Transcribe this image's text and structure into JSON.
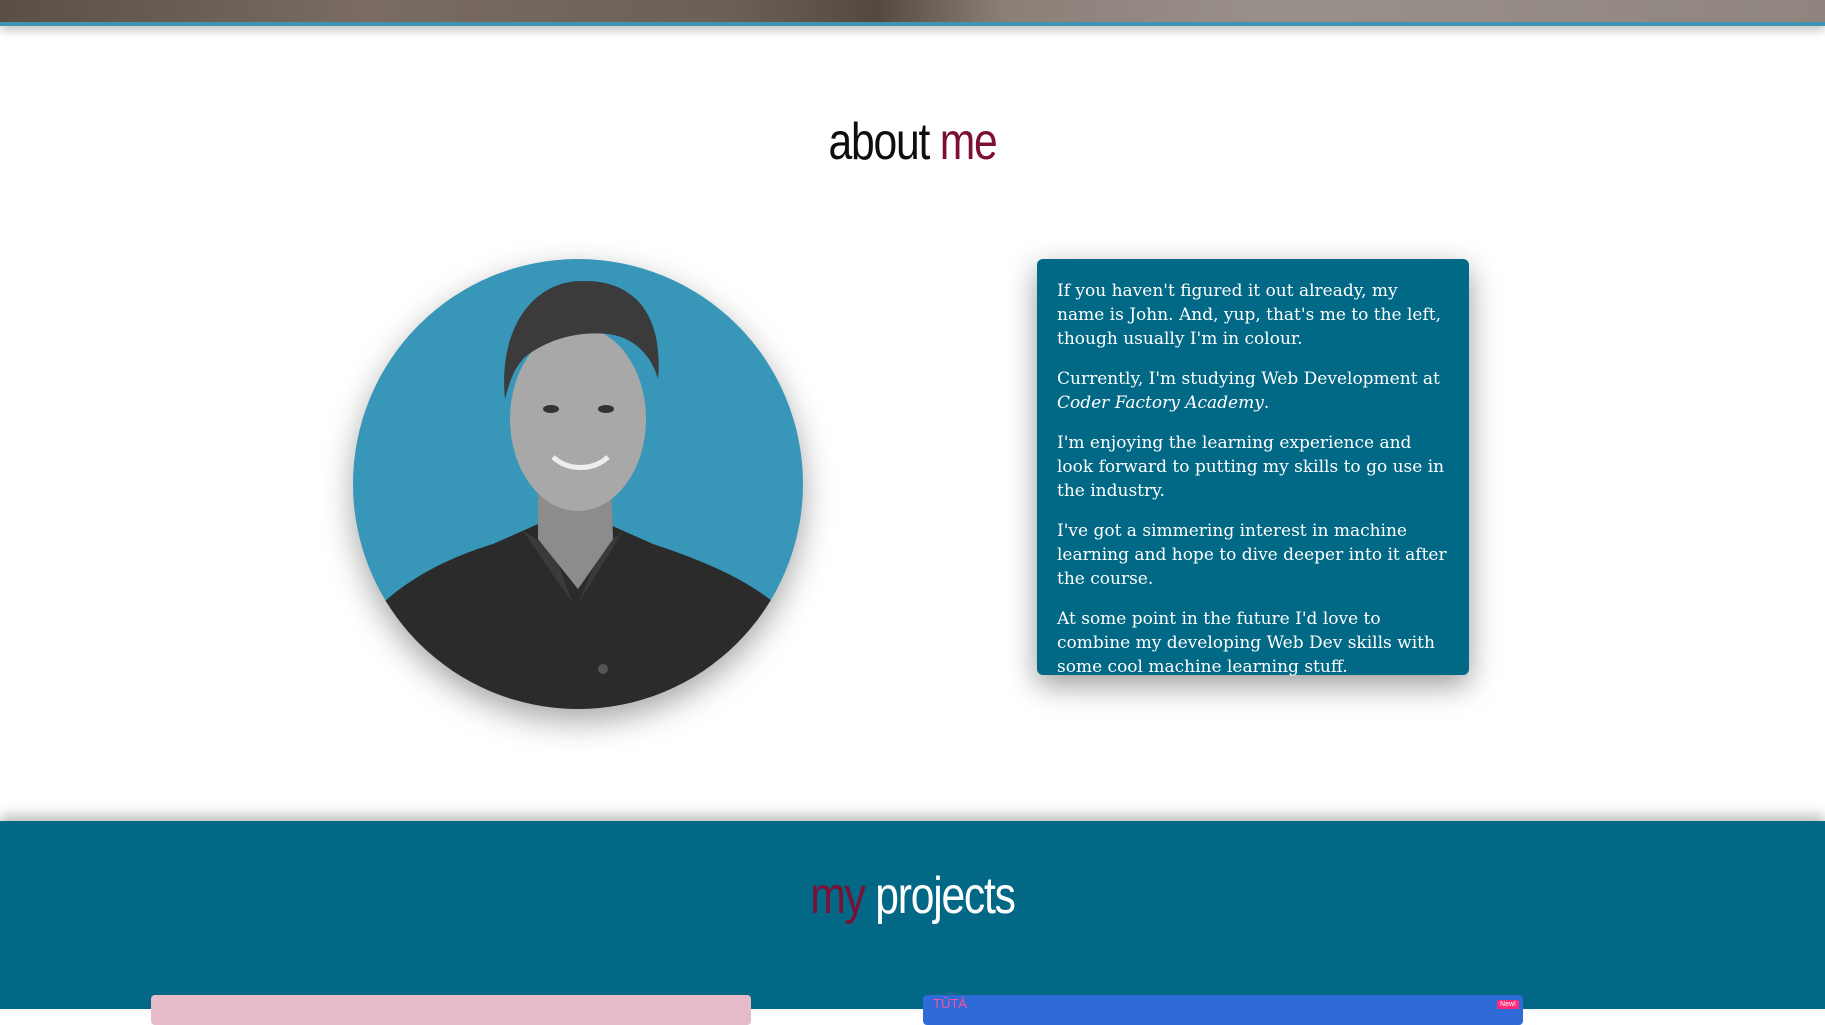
{
  "about": {
    "title_word_1": "about",
    "title_word_2": "me",
    "bio_p1": "If you haven't figured it out already, my name is John. And, yup, that's me to the left, though usually I'm in colour.",
    "bio_p2_prefix": "Currently, I'm studying Web Development at ",
    "bio_p2_school": "Coder Factory Academy",
    "bio_p2_suffix": ".",
    "bio_p3": "I'm enjoying the learning experience and look forward to putting my skills to go use in the industry.",
    "bio_p4": "I've got a simmering interest in machine learning and hope to dive deeper into it after the course.",
    "bio_p5": "At some point in the future I'd love to combine my developing Web Dev skills with some cool machine learning stuff."
  },
  "projects": {
    "title_word_1": "my",
    "title_word_2": "projects",
    "card_2_label": "TŪTĀ",
    "card_2_badge": "New!"
  },
  "colors": {
    "accent": "#7c0f35",
    "teal_dark": "#016886",
    "teal_light": "#3896b8",
    "text_dark": "#0e0e0e"
  }
}
